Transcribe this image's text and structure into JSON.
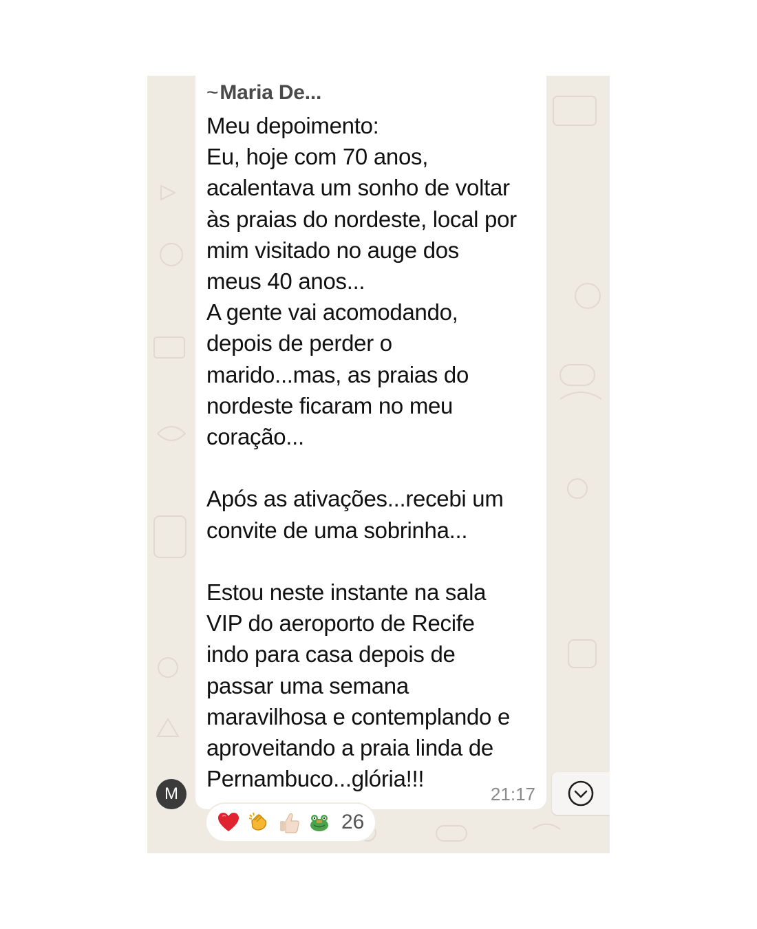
{
  "message": {
    "sender": "Maria De...",
    "sender_prefix": "~",
    "text": "Meu depoimento:\nEu, hoje com 70 anos,\nacalentava um sonho de voltar\nàs praias do nordeste, local por\nmim visitado no auge dos\nmeus 40 anos...\nA gente vai acomodando,\ndepois de perder o\nmarido...mas, as praias do\nnordeste ficaram no meu\ncoração...\n\nApós as ativações...recebi um\nconvite de uma sobrinha...\n\nEstou neste instante na sala\nVIP do aeroporto de Recife\nindo para casa depois de\npassar uma semana\nmaravilhosa e contemplando e\naproveitando a praia linda de\nPernambuco...glória!!!",
    "time": "21:17",
    "avatar_initial": "M"
  },
  "reactions": {
    "emojis": [
      "heart-icon",
      "clapping-hands-icon",
      "thumbs-up-icon",
      "frog-icon"
    ],
    "count": "26"
  },
  "colors": {
    "chat_background": "#efeae2",
    "bubble": "#ffffff",
    "avatar": "#3b3b3b",
    "heart": "#e0242f"
  },
  "icons": {
    "scroll_down": "chevron-down-circle-icon"
  }
}
